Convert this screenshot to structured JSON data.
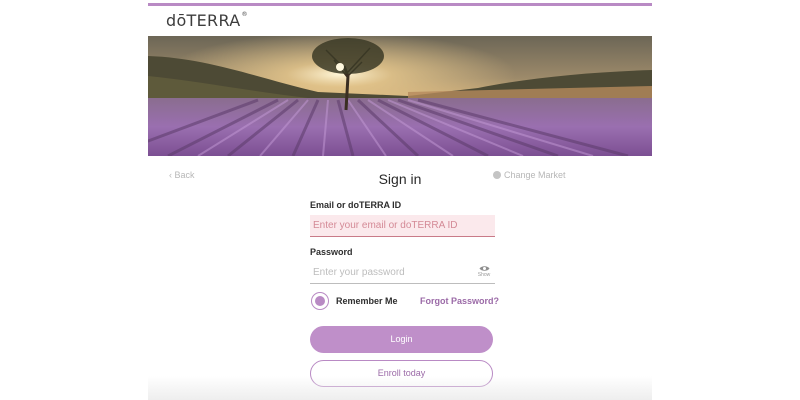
{
  "brand": {
    "logo_text": "dōTERRA",
    "accent_color": "#b98ac4"
  },
  "hero": {
    "image_description_icon": "lavender-field-sunset-image"
  },
  "nav": {
    "back_label": "Back",
    "back_icon": "chevron-left-icon",
    "title": "Sign in",
    "change_market_label": "Change Market",
    "change_market_icon": "globe-icon"
  },
  "form": {
    "email_label": "Email or doTERRA ID",
    "email_placeholder": "Enter your email or doTERRA ID",
    "email_value": "",
    "password_label": "Password",
    "password_placeholder": "Enter your password",
    "password_value": "",
    "show_label": "Show",
    "show_icon": "eye-icon",
    "remember_label": "Remember Me",
    "remember_checked": true,
    "forgot_label": "Forgot Password?"
  },
  "actions": {
    "login_label": "Login",
    "enroll_label": "Enroll today"
  }
}
